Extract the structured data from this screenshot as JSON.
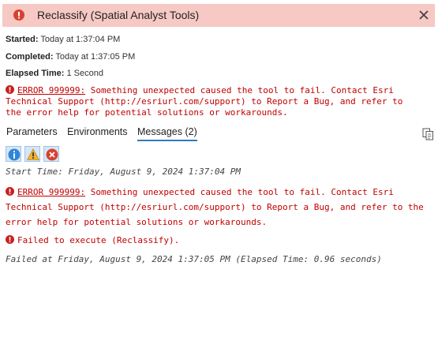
{
  "header": {
    "title": "Reclassify (Spatial Analyst Tools)",
    "status_icon": "error-circle-icon",
    "close_icon": "close-icon"
  },
  "summary": {
    "started_label": "Started:",
    "started_value": "Today at 1:37:04 PM",
    "completed_label": "Completed:",
    "completed_value": "Today at 1:37:05 PM",
    "elapsed_label": "Elapsed Time:",
    "elapsed_value": "1 Second"
  },
  "summary_error": {
    "code": "ERROR 999999:",
    "line1": " Something unexpected caused the tool to fail. Contact Esri",
    "line2": "Technical Support (http://esriurl.com/support) to Report a Bug, and refer to",
    "line3": "the error help for potential solutions or workarounds."
  },
  "tabs": [
    {
      "label": "Parameters",
      "active": false
    },
    {
      "label": "Environments",
      "active": false
    },
    {
      "label": "Messages (2)",
      "active": true
    }
  ],
  "filters": [
    {
      "name": "info-filter-icon"
    },
    {
      "name": "warning-filter-icon"
    },
    {
      "name": "error-filter-icon"
    }
  ],
  "messages": {
    "start_time": "Start Time: Friday, August 9, 2024 1:37:04 PM",
    "error_code": "ERROR 999999:",
    "error_line1": " Something unexpected caused the tool to fail. Contact Esri",
    "error_line2": "Technical Support (http://esriurl.com/support) to Report a Bug, and refer to the",
    "error_line3": "error help for potential solutions or workarounds.",
    "failed_exec": "Failed to execute (Reclassify).",
    "failed_at": "Failed at Friday, August 9, 2024 1:37:05 PM (Elapsed Time: 0.96 seconds)"
  },
  "colors": {
    "header_bg": "#f7c9c4",
    "error_red": "#c00000",
    "tab_underline": "#2f79c6"
  }
}
